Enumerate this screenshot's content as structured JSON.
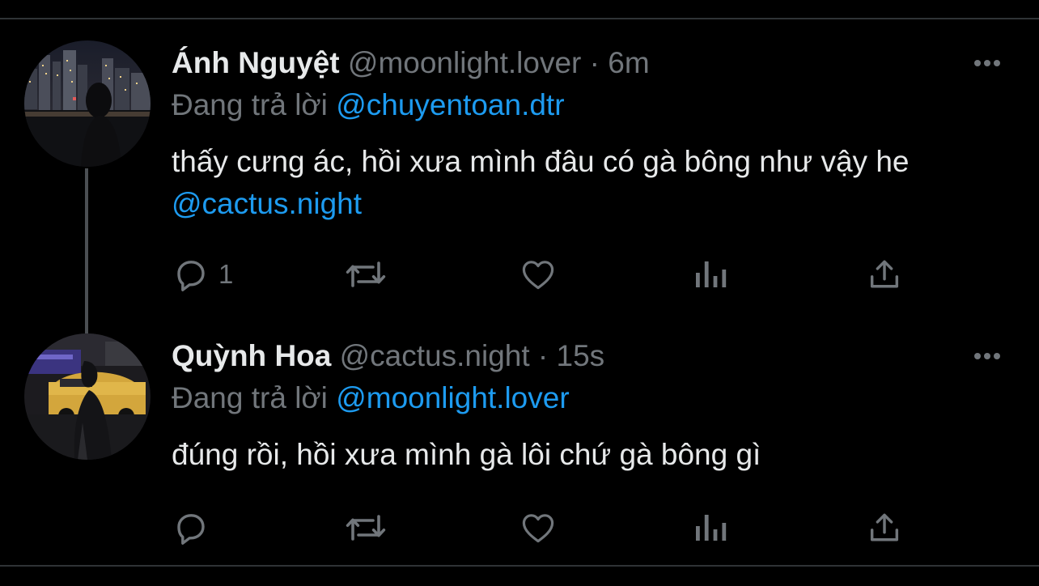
{
  "colors": {
    "background": "#000000",
    "text_primary": "#e7e9ea",
    "text_secondary": "#71767b",
    "mention": "#1d9bf0",
    "divider": "#2f3336"
  },
  "tweets": [
    {
      "display_name": "Ánh Nguyệt",
      "handle": "@moonlight.lover",
      "separator": "·",
      "time": "6m",
      "replying_to_label": "Đang trả lời",
      "replying_to_handle": "@chuyentoan.dtr",
      "text": "thấy cưng ác, hồi xưa mình đâu có gà bông như vậy he",
      "text_mention": "@cactus.night",
      "avatar_icon": "avatar-city-night-photo",
      "reply_count": "1"
    },
    {
      "display_name": "Quỳnh Hoa",
      "handle": "@cactus.night",
      "separator": "·",
      "time": "15s",
      "replying_to_label": "Đang trả lời",
      "replying_to_handle": "@moonlight.lover",
      "text": "đúng rồi, hồi xưa mình gà lôi chứ gà bông gì",
      "avatar_icon": "avatar-street-taxi-photo",
      "reply_count": ""
    }
  ],
  "action_icons": [
    "reply-icon",
    "retweet-icon",
    "like-icon",
    "views-icon",
    "share-icon"
  ]
}
